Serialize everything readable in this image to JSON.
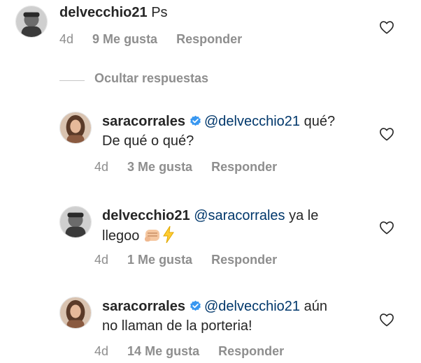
{
  "comments": [
    {
      "username": "delvecchio21",
      "mention": "",
      "text": "Ps",
      "age": "4d",
      "likes": "9 Me gusta",
      "reply": "Responder"
    },
    {
      "username": "saracorrales",
      "mention": "@delvecchio21",
      "text_line1": "qué?",
      "text_line2": "De qué o qué?",
      "age": "4d",
      "likes": "3 Me gusta",
      "reply": "Responder"
    },
    {
      "username": "delvecchio21",
      "mention": "@saracorrales",
      "text_line1": "ya le",
      "text_line2": "llegoo",
      "age": "4d",
      "likes": "1 Me gusta",
      "reply": "Responder"
    },
    {
      "username": "saracorrales",
      "mention": "@delvecchio21",
      "text_line1": "aún",
      "text_line2": "no llaman de la porteria!",
      "age": "4d",
      "likes": "14 Me gusta",
      "reply": "Responder"
    }
  ],
  "hide_replies": "Ocultar respuestas",
  "colors": {
    "mention": "#00376b",
    "verified": "#3897f0",
    "meta": "#8e8e8e"
  },
  "icons": {
    "like": "heart-outline-icon",
    "verified": "verified-badge-icon",
    "emoji1": "fist-emoji",
    "emoji2": "lightning-emoji"
  }
}
